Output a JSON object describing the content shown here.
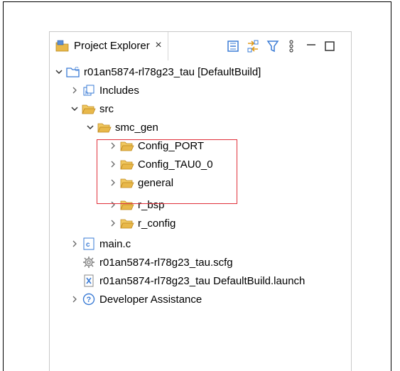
{
  "project_explorer": {
    "tab_label": "Project Explorer",
    "tab_close": "×",
    "toolbar": {
      "collapse_all": "collapse-all-icon",
      "link_with_editor": "link-with-editor-icon",
      "filter": "filter-icon",
      "view_menu": "view-menu-icon",
      "minimize": "minimize-icon",
      "maximize": "maximize-icon"
    },
    "tree": {
      "project": {
        "label": "r01an5874-rl78g23_tau [DefaultBuild]",
        "expanded": true
      },
      "includes": {
        "label": "Includes",
        "expanded": false
      },
      "src": {
        "label": "src",
        "expanded": true
      },
      "smc_gen": {
        "label": "smc_gen",
        "expanded": true
      },
      "config_port": {
        "label": "Config_PORT",
        "expanded": false
      },
      "config_tau0_0": {
        "label": "Config_TAU0_0",
        "expanded": false
      },
      "general": {
        "label": "general",
        "expanded": false
      },
      "r_bsp": {
        "label": "r_bsp",
        "expanded": false
      },
      "r_config": {
        "label": "r_config",
        "expanded": false
      },
      "main_c": {
        "label": "main.c",
        "expanded": false
      },
      "scfg": {
        "label": "r01an5874-rl78g23_tau.scfg"
      },
      "launch": {
        "label": "r01an5874-rl78g23_tau DefaultBuild.launch"
      },
      "developer_assistance": {
        "label": "Developer Assistance",
        "expanded": false
      }
    },
    "colors": {
      "folder": "#e8b84a",
      "highlight": "#e0303a",
      "toolbar_blue": "#3a7bd5"
    }
  }
}
